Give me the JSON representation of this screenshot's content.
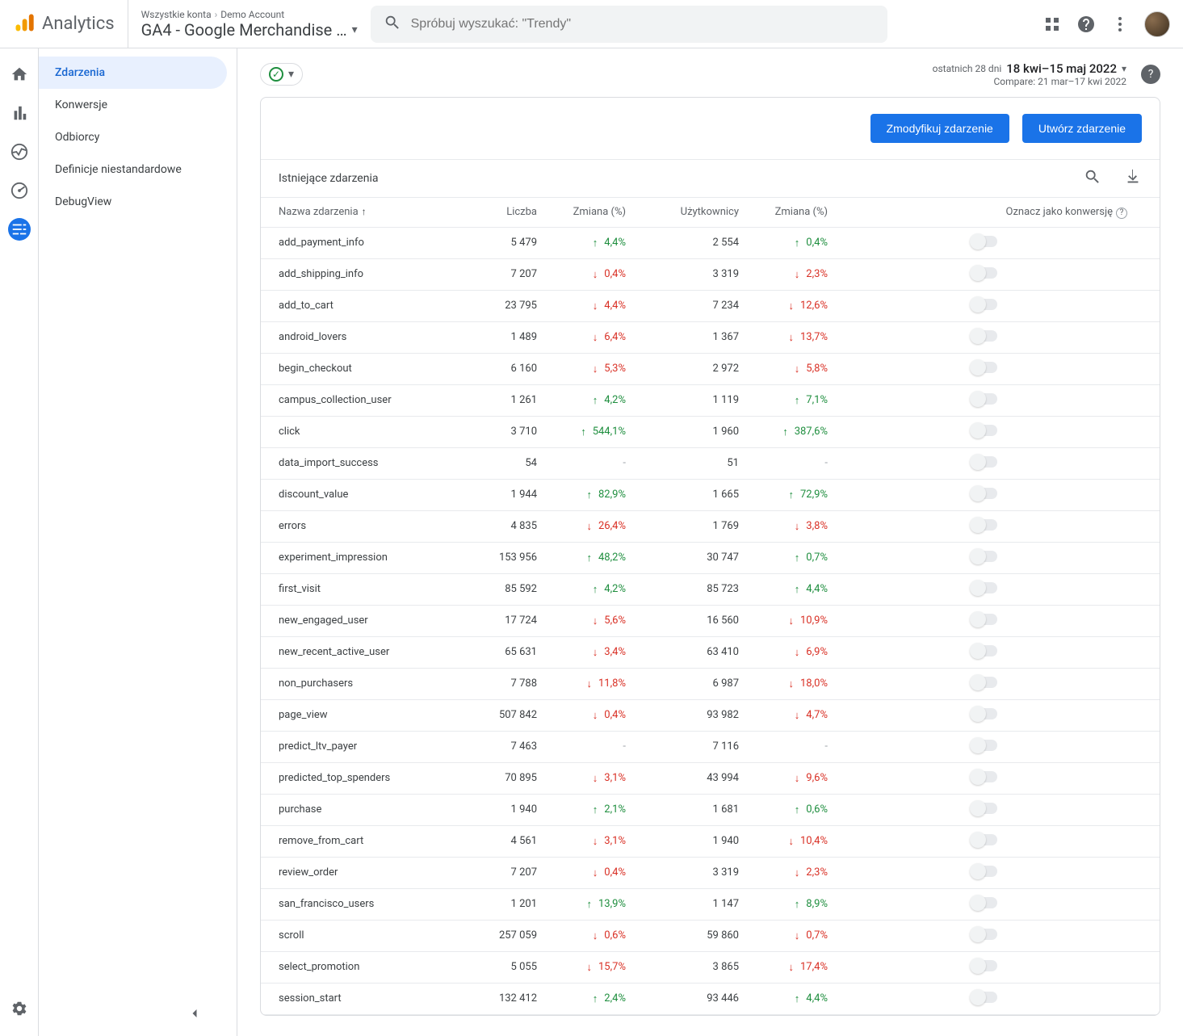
{
  "header": {
    "brand": "Analytics",
    "breadcrumb_all": "Wszystkie konta",
    "breadcrumb_account": "Demo Account",
    "property": "GA4 - Google Merchandise …",
    "search_placeholder": "Spróbuj wyszukać: \"Trendy\""
  },
  "sidebar": {
    "items": [
      "Zdarzenia",
      "Konwersje",
      "Odbiorcy",
      "Definicje niestandardowe",
      "DebugView"
    ],
    "selected": 0
  },
  "daterange": {
    "prefix": "ostatnich 28 dni",
    "range": "18 kwi–15 maj 2022",
    "compare": "Compare: 21 mar–17 kwi 2022"
  },
  "buttons": {
    "modify": "Zmodyfikuj zdarzenie",
    "create": "Utwórz zdarzenie"
  },
  "table": {
    "title": "Istniejące zdarzenia",
    "cols": {
      "name": "Nazwa zdarzenia",
      "count": "Liczba",
      "change": "Zmiana (%)",
      "users": "Użytkownicy",
      "uchange": "Zmiana (%)",
      "mark": "Oznacz jako konwersję"
    },
    "rows": [
      {
        "name": "add_payment_info",
        "count": "5 479",
        "c1": "4,4%",
        "d1": "up",
        "users": "2 554",
        "c2": "0,4%",
        "d2": "up"
      },
      {
        "name": "add_shipping_info",
        "count": "7 207",
        "c1": "0,4%",
        "d1": "down",
        "users": "3 319",
        "c2": "2,3%",
        "d2": "down"
      },
      {
        "name": "add_to_cart",
        "count": "23 795",
        "c1": "4,4%",
        "d1": "down",
        "users": "7 234",
        "c2": "12,6%",
        "d2": "down"
      },
      {
        "name": "android_lovers",
        "count": "1 489",
        "c1": "6,4%",
        "d1": "down",
        "users": "1 367",
        "c2": "13,7%",
        "d2": "down"
      },
      {
        "name": "begin_checkout",
        "count": "6 160",
        "c1": "5,3%",
        "d1": "down",
        "users": "2 972",
        "c2": "5,8%",
        "d2": "down"
      },
      {
        "name": "campus_collection_user",
        "count": "1 261",
        "c1": "4,2%",
        "d1": "up",
        "users": "1 119",
        "c2": "7,1%",
        "d2": "up"
      },
      {
        "name": "click",
        "count": "3 710",
        "c1": "544,1%",
        "d1": "up",
        "users": "1 960",
        "c2": "387,6%",
        "d2": "up"
      },
      {
        "name": "data_import_success",
        "count": "54",
        "c1": "-",
        "d1": "none",
        "users": "51",
        "c2": "-",
        "d2": "none"
      },
      {
        "name": "discount_value",
        "count": "1 944",
        "c1": "82,9%",
        "d1": "up",
        "users": "1 665",
        "c2": "72,9%",
        "d2": "up"
      },
      {
        "name": "errors",
        "count": "4 835",
        "c1": "26,4%",
        "d1": "down",
        "users": "1 769",
        "c2": "3,8%",
        "d2": "down"
      },
      {
        "name": "experiment_impression",
        "count": "153 956",
        "c1": "48,2%",
        "d1": "up",
        "users": "30 747",
        "c2": "0,7%",
        "d2": "up"
      },
      {
        "name": "first_visit",
        "count": "85 592",
        "c1": "4,2%",
        "d1": "up",
        "users": "85 723",
        "c2": "4,4%",
        "d2": "up"
      },
      {
        "name": "new_engaged_user",
        "count": "17 724",
        "c1": "5,6%",
        "d1": "down",
        "users": "16 560",
        "c2": "10,9%",
        "d2": "down"
      },
      {
        "name": "new_recent_active_user",
        "count": "65 631",
        "c1": "3,4%",
        "d1": "down",
        "users": "63 410",
        "c2": "6,9%",
        "d2": "down"
      },
      {
        "name": "non_purchasers",
        "count": "7 788",
        "c1": "11,8%",
        "d1": "down",
        "users": "6 987",
        "c2": "18,0%",
        "d2": "down"
      },
      {
        "name": "page_view",
        "count": "507 842",
        "c1": "0,4%",
        "d1": "down",
        "users": "93 982",
        "c2": "4,7%",
        "d2": "down"
      },
      {
        "name": "predict_ltv_payer",
        "count": "7 463",
        "c1": "-",
        "d1": "none",
        "users": "7 116",
        "c2": "-",
        "d2": "none"
      },
      {
        "name": "predicted_top_spenders",
        "count": "70 895",
        "c1": "3,1%",
        "d1": "down",
        "users": "43 994",
        "c2": "9,6%",
        "d2": "down"
      },
      {
        "name": "purchase",
        "count": "1 940",
        "c1": "2,1%",
        "d1": "up",
        "users": "1 681",
        "c2": "0,6%",
        "d2": "up"
      },
      {
        "name": "remove_from_cart",
        "count": "4 561",
        "c1": "3,1%",
        "d1": "down",
        "users": "1 940",
        "c2": "10,4%",
        "d2": "down"
      },
      {
        "name": "review_order",
        "count": "7 207",
        "c1": "0,4%",
        "d1": "down",
        "users": "3 319",
        "c2": "2,3%",
        "d2": "down"
      },
      {
        "name": "san_francisco_users",
        "count": "1 201",
        "c1": "13,9%",
        "d1": "up",
        "users": "1 147",
        "c2": "8,9%",
        "d2": "up"
      },
      {
        "name": "scroll",
        "count": "257 059",
        "c1": "0,6%",
        "d1": "down",
        "users": "59 860",
        "c2": "0,7%",
        "d2": "down"
      },
      {
        "name": "select_promotion",
        "count": "5 055",
        "c1": "15,7%",
        "d1": "down",
        "users": "3 865",
        "c2": "17,4%",
        "d2": "down"
      },
      {
        "name": "session_start",
        "count": "132 412",
        "c1": "2,4%",
        "d1": "up",
        "users": "93 446",
        "c2": "4,4%",
        "d2": "up"
      }
    ]
  }
}
